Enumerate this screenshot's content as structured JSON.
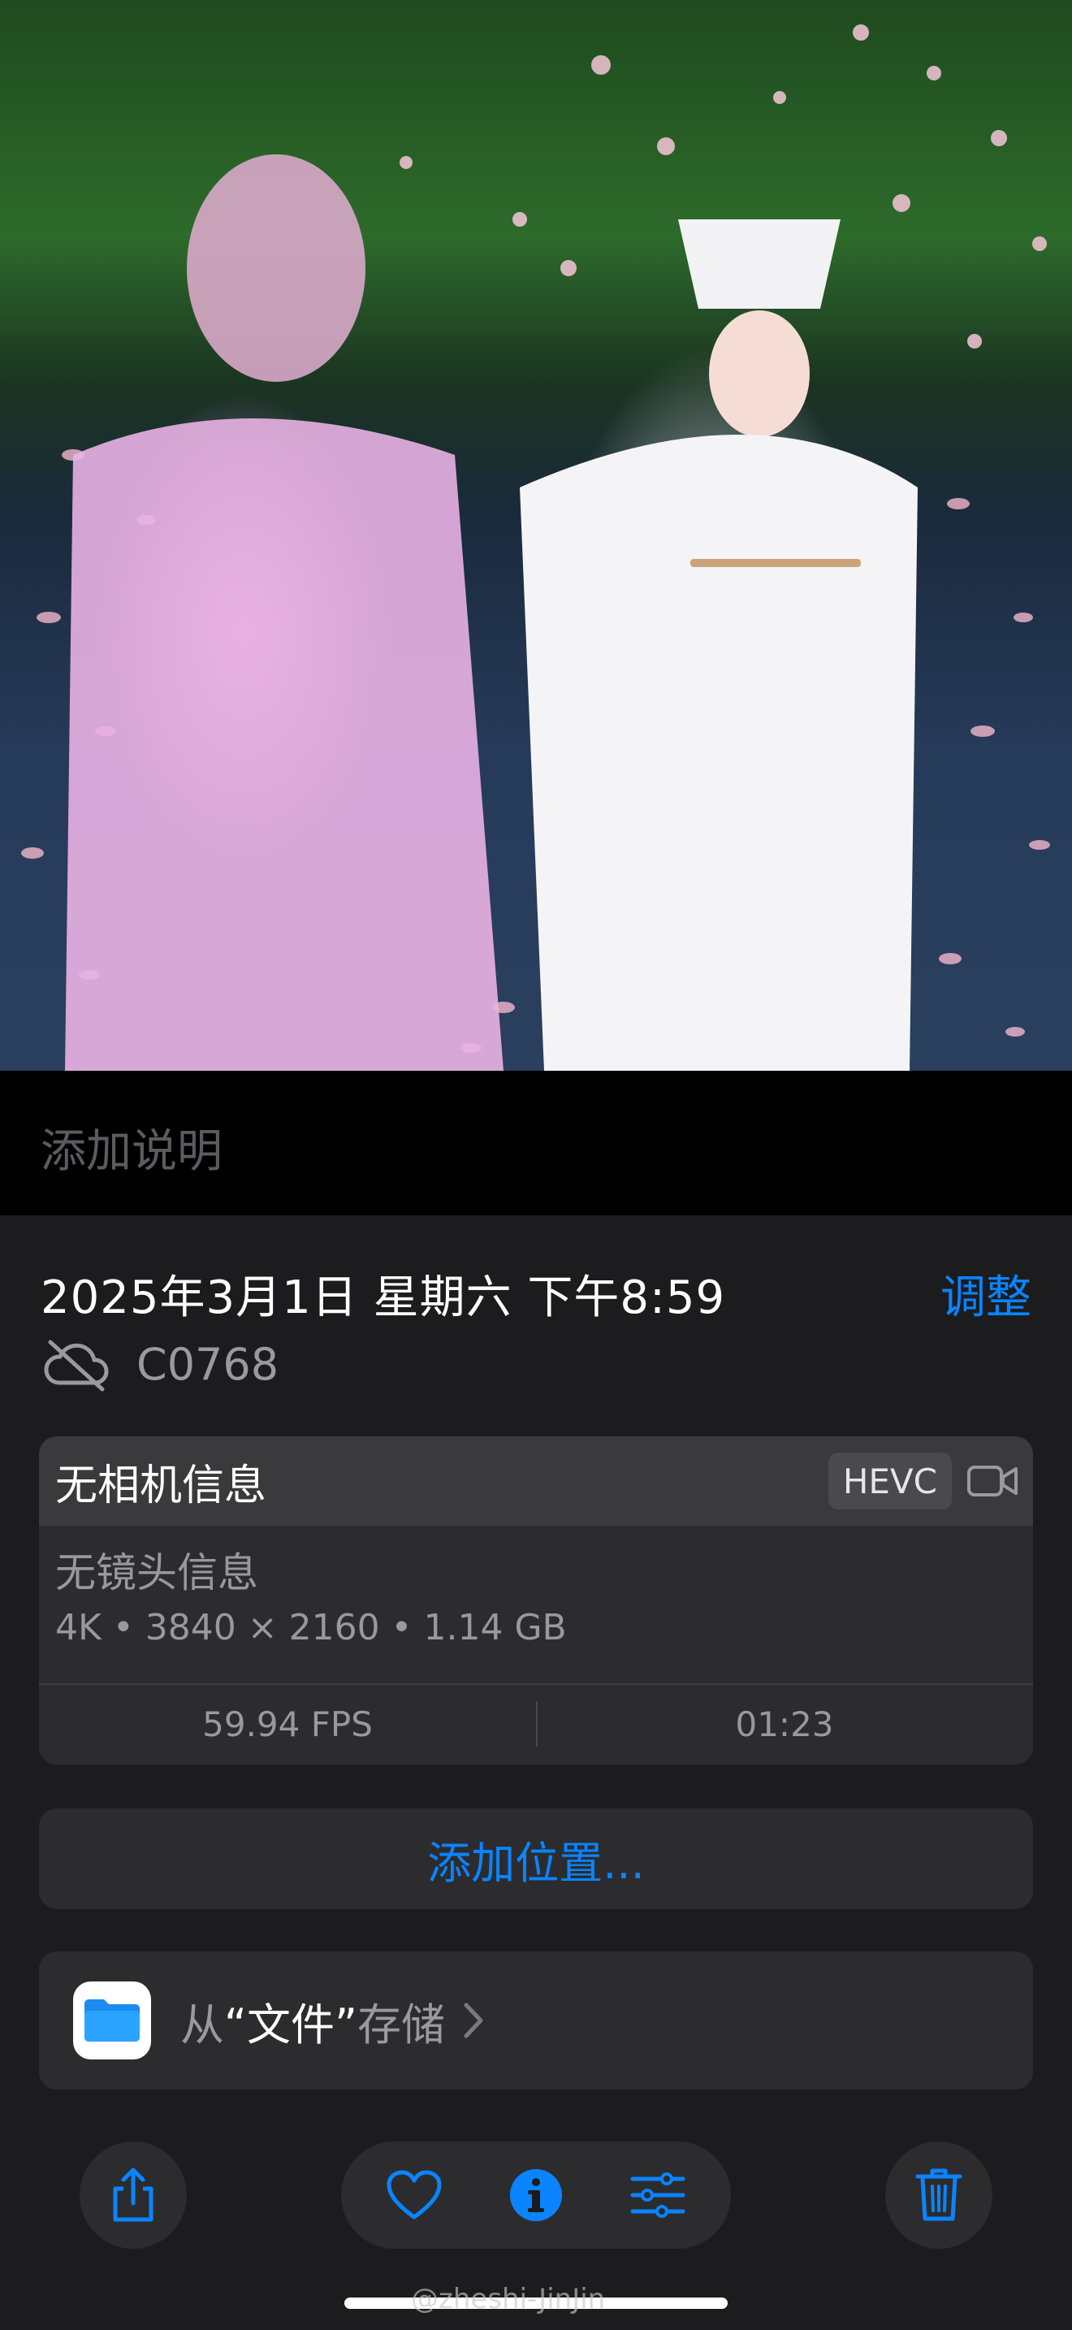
{
  "caption": {
    "placeholder": "添加说明"
  },
  "info": {
    "date": "2025年3月1日 星期六 下午8:59",
    "adjust_label": "调整",
    "filename": "C0768"
  },
  "camera_card": {
    "title": "无相机信息",
    "codec_badge": "HEVC",
    "lens": "无镜头信息",
    "specs": "4K • 3840 × 2160 • 1.14 GB",
    "fps": "59.94 FPS",
    "duration": "01:23"
  },
  "location": {
    "label": "添加位置..."
  },
  "files": {
    "prefix": "从",
    "quoted": "“文件”",
    "suffix": "存储"
  },
  "watermark": "@zheshi-JinJin",
  "colors": {
    "accent": "#0a84ff",
    "panel": "#1c1c1e",
    "card": "#2c2c2e"
  },
  "icons": [
    "share-icon",
    "heart-icon",
    "info-icon",
    "adjust-sliders-icon",
    "trash-icon",
    "cloud-off-icon",
    "video-camera-icon",
    "files-app-icon",
    "chevron-right-icon"
  ]
}
